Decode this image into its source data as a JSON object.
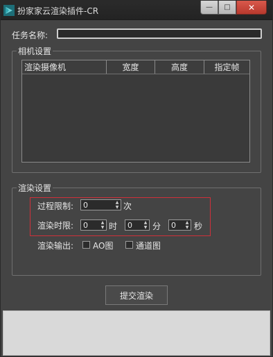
{
  "window": {
    "title": "扮家家云渲染插件-CR",
    "controls": {
      "minimize": "—",
      "maximize": "□",
      "close": "✕"
    }
  },
  "task": {
    "label": "任务名称:",
    "value": ""
  },
  "camera_group": {
    "title": "相机设置",
    "columns": [
      "渲染摄像机",
      "宽度",
      "高度",
      "指定帧"
    ],
    "rows": []
  },
  "render_group": {
    "title": "渲染设置",
    "pass_limit": {
      "label": "过程限制:",
      "value": "0",
      "unit": "次"
    },
    "time_limit": {
      "label": "渲染时限:",
      "hours": {
        "value": "0",
        "unit": "时"
      },
      "minutes": {
        "value": "0",
        "unit": "分"
      },
      "seconds": {
        "value": "0",
        "unit": "秒"
      }
    },
    "output": {
      "label": "渲染输出:",
      "ao": {
        "label": "AO图",
        "checked": false
      },
      "channel": {
        "label": "通道图",
        "checked": false
      }
    }
  },
  "submit": {
    "label": "提交渲染"
  }
}
